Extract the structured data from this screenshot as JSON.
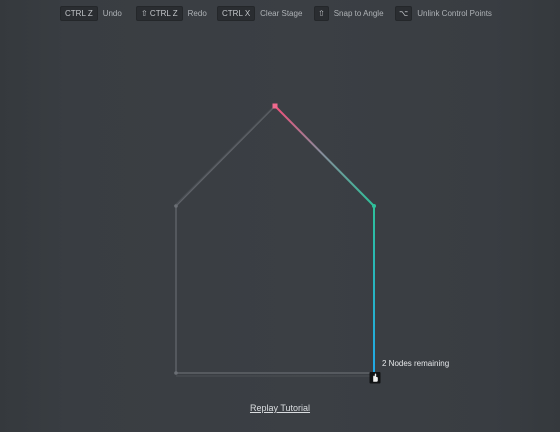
{
  "toolbar": {
    "undo": {
      "key": "CTRL Z",
      "label": "Undo"
    },
    "redo": {
      "key": "⇧ CTRL Z",
      "label": "Redo"
    },
    "clear": {
      "key": "CTRL X",
      "label": "Clear Stage"
    },
    "snap": {
      "key": "⇧",
      "label": "Snap to Angle"
    },
    "unlink": {
      "key": "⌥",
      "label": "Unlink Control Points"
    }
  },
  "status": {
    "nodes_remaining": "2 Nodes remaining"
  },
  "footer": {
    "replay_label": "Replay Tutorial"
  },
  "colors": {
    "background": "#393d42",
    "guide": "#5f6369",
    "path_start": "#f0507a",
    "path_mid": "#2ec09a",
    "path_end": "#21a8e8",
    "node_active": "#f06a8e"
  },
  "icons": {
    "cursor": "hand-cursor-icon"
  }
}
